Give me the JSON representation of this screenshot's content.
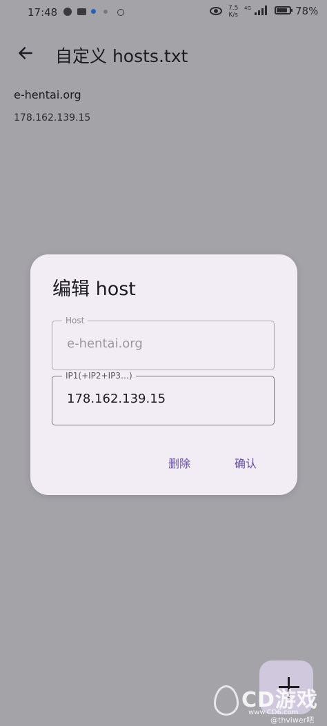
{
  "status_bar": {
    "time": "17:48",
    "net_speed_value": "7.5",
    "net_speed_unit": "K/s",
    "network_type": "4G",
    "battery": "78%"
  },
  "app_bar": {
    "title": "自定义 hosts.txt",
    "back_icon": "arrow-left-icon"
  },
  "hosts": [
    {
      "host": "e-hentai.org",
      "ip": "178.162.139.15"
    }
  ],
  "dialog": {
    "title": "编辑 host",
    "host_field": {
      "label": "Host",
      "value": "e-hentai.org"
    },
    "ip_field": {
      "label": "IP1(+IP2+IP3…)",
      "value": "178.162.139.15"
    },
    "delete_label": "删除",
    "confirm_label": "确认",
    "accent_color": "#6750a4"
  },
  "fab": {
    "icon": "plus-icon"
  },
  "watermark": {
    "brand": "CD游戏",
    "site": "www.CD6.com",
    "user": "@thviwer吧"
  }
}
